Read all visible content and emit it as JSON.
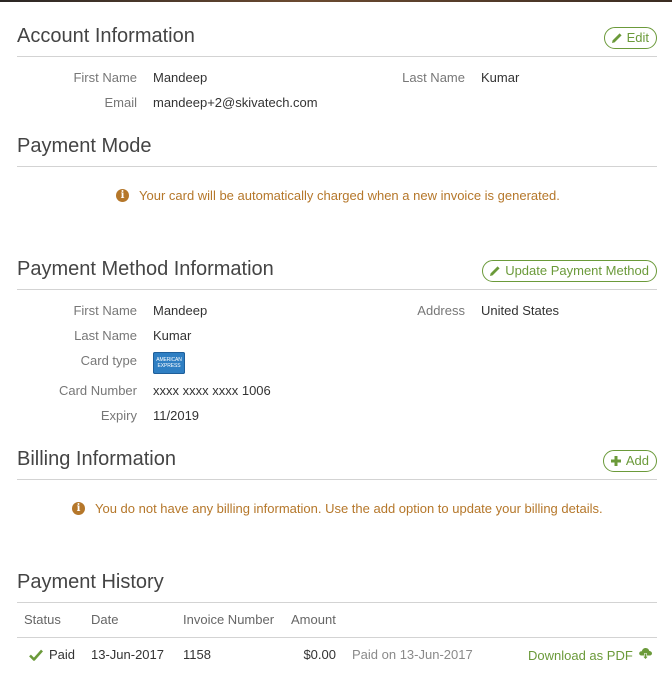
{
  "account": {
    "title": "Account Information",
    "edit_label": "Edit",
    "first_name_label": "First Name",
    "first_name": "Mandeep",
    "last_name_label": "Last Name",
    "last_name": "Kumar",
    "email_label": "Email",
    "email": "mandeep+2@skivatech.com"
  },
  "payment_mode": {
    "title": "Payment Mode",
    "notice": "Your card will be automatically charged when a new invoice is generated."
  },
  "payment_method": {
    "title": "Payment Method Information",
    "update_label": "Update Payment Method",
    "first_name_label": "First Name",
    "first_name": "Mandeep",
    "last_name_label": "Last Name",
    "last_name": "Kumar",
    "card_type_label": "Card type",
    "card_logo_line1": "AMERICAN",
    "card_logo_line2": "EXPRESS",
    "card_number_label": "Card Number",
    "card_number": "xxxx xxxx xxxx 1006",
    "expiry_label": "Expiry",
    "expiry": "11/2019",
    "address_label": "Address",
    "address": "United States"
  },
  "billing": {
    "title": "Billing Information",
    "add_label": "Add",
    "notice": "You do not have any billing information. Use the add option to update your billing details."
  },
  "history": {
    "title": "Payment History",
    "columns": [
      "Status",
      "Date",
      "Invoice Number",
      "Amount"
    ],
    "rows": [
      {
        "status": "Paid",
        "date": "13-Jun-2017",
        "invoice": "1158",
        "amount": "$0.00",
        "paid_on": "Paid on 13-Jun-2017",
        "download_label": "Download as PDF"
      }
    ]
  },
  "colors": {
    "accent_green": "#6b9a3a",
    "notice_orange": "#b5772a",
    "amex_blue": "#2f7fc3"
  },
  "icons": {
    "edit": "pencil-icon",
    "update": "pencil-icon",
    "add": "plus-icon",
    "info": "info-icon",
    "status": "checkmark-icon",
    "download": "cloud-download-icon"
  }
}
